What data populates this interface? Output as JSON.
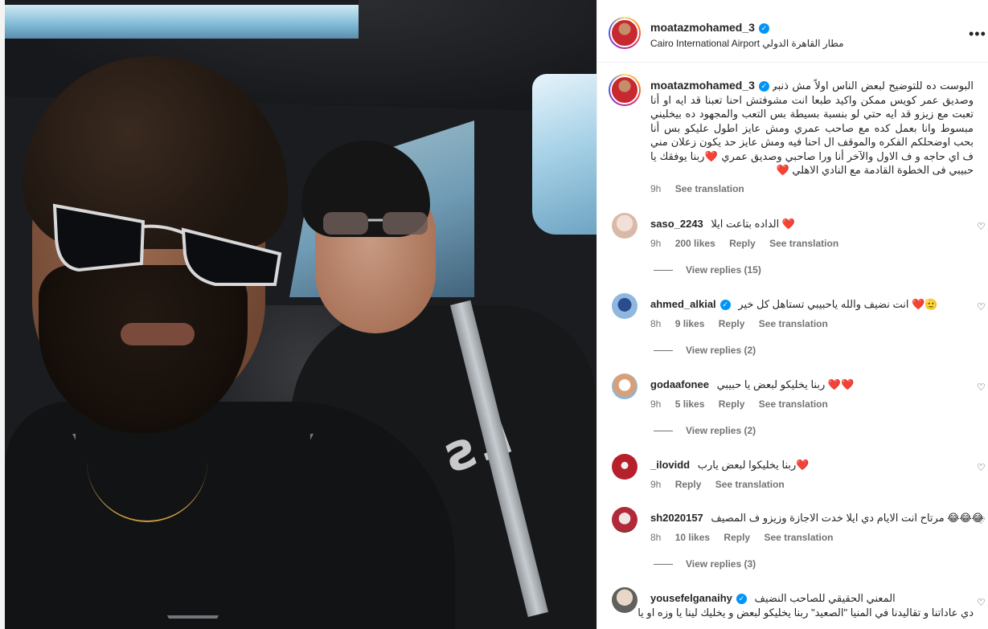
{
  "post": {
    "username": "moatazmohamed_3",
    "location": "Cairo International Airport مطار القاهرة الدولي",
    "more_icon": "more-horizontal-icon",
    "shirt_print": "ƨ⅃"
  },
  "caption": {
    "username": "moatazmohamed_3",
    "text": "البوست ده للتوضيح لبعض الناس اولاً مش ذنبي ان انت ملقتش صاحب وأخ وصديق عمر كويس ممكن واكيد طبعا انت مشوفتش احنا تعبنا قد ايه او أنا تعبت مع زيزو قد ايه حتي لو بنسبة بسيطة بس التعب والمجهود ده بيخليني مبسوط وانا بعمل كده مع صاحب عمري ومش عايز اطول عليكو بس أنا بحب اوضحلكم الفكره والموقف ال احنا فيه ومش عايز حد يكون زعلان مني ف اي حاجه و ف الاول والآخر أنا ورا صاحبي وصديق عمري ❤️ربنا يوفقك يا حبيبي فى الخطوة القادمة مع النادي الاهلي ❤️",
    "time": "9h",
    "see_translation": "See translation"
  },
  "comments": [
    {
      "username": "saso_2243",
      "verified": false,
      "text": "الداده بتاعت ايلا ❤️",
      "time": "9h",
      "likes": "200 likes",
      "reply": "Reply",
      "see_translation": "See translation",
      "view_replies": "View replies (15)"
    },
    {
      "username": "ahmed_alkial",
      "verified": true,
      "text": "انت نضيف والله ياحبيبي تستاهل كل خير ❤️🫡",
      "time": "8h",
      "likes": "9 likes",
      "reply": "Reply",
      "see_translation": "See translation",
      "view_replies": "View replies (2)"
    },
    {
      "username": "godaafonee",
      "verified": false,
      "text": "ربنا يخليكو لبعض يا حبيبي ❤️❤️",
      "time": "9h",
      "likes": "5 likes",
      "reply": "Reply",
      "see_translation": "See translation",
      "view_replies": "View replies (2)"
    },
    {
      "username": "_ilovidd",
      "verified": false,
      "text": "ربنا يخليكوا لبعض يارب❤️",
      "time": "9h",
      "likes": "",
      "reply": "Reply",
      "see_translation": "See translation",
      "view_replies": ""
    },
    {
      "username": "sh2020157",
      "verified": false,
      "text": "مرتاح انت الايام دي ايلا خدت الاجازة وزيزو ف المصيف 😂😂😂",
      "time": "8h",
      "likes": "10 likes",
      "reply": "Reply",
      "see_translation": "See translation",
      "view_replies": "View replies (3)"
    },
    {
      "username": "yousefelganaihy",
      "verified": true,
      "text": "المعني الحقيقي للصاحب النضيف",
      "text2": "دي عاداتنا و تقاليدنا في المنيا \"الصعيد\" ربنا يخليكو لبعض و يخليك لينا يا وزه او يا",
      "time": "",
      "likes": "",
      "reply": "",
      "see_translation": "",
      "view_replies": ""
    }
  ],
  "icons": {
    "heart": "heart-outline-icon",
    "verified": "verified-badge-icon"
  }
}
